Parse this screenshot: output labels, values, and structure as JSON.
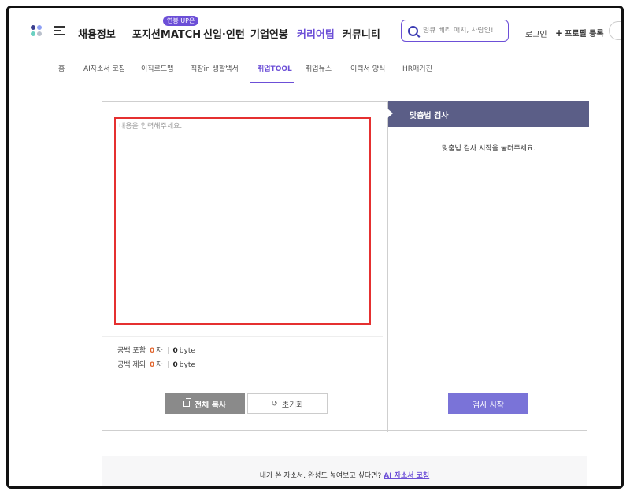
{
  "nav": {
    "items": [
      {
        "label": "채용정보"
      },
      {
        "label": "포지션MATCH"
      },
      {
        "label": "신입·인턴"
      },
      {
        "label": "기업연봉"
      },
      {
        "label": "커리어팁"
      },
      {
        "label": "커뮤니티"
      }
    ],
    "badge": "연봉 UP은",
    "search_placeholder": "멍큐 베리 매치, 사람인!",
    "login": "로그인",
    "profile_plus": "+",
    "profile": "프로필 등록"
  },
  "subnav": {
    "items": [
      {
        "label": "홈"
      },
      {
        "label": "AI자소서 코칭"
      },
      {
        "label": "이직로드맵"
      },
      {
        "label": "직장in 생활백서"
      },
      {
        "label": "취업TOOL"
      },
      {
        "label": "취업뉴스"
      },
      {
        "label": "이력서 양식"
      },
      {
        "label": "HR매거진"
      }
    ]
  },
  "editor": {
    "placeholder": "내용을 입력해주세요."
  },
  "counts": {
    "with_space_label": "공백 포함",
    "without_space_label": "공백 제외",
    "chars_with_space": "0",
    "chars_without_space": "0",
    "char_unit": "자",
    "bytes_with_space": "0",
    "bytes_without_space": "0",
    "byte_unit": "byte"
  },
  "buttons": {
    "copy_all": "전체 복사",
    "reset": "초기화",
    "check_start": "검사 시작"
  },
  "spellcheck": {
    "title": "맞춤법 검사",
    "message": "맞춤법 검사 시작을 눌러주세요."
  },
  "promo": {
    "text": "내가 쓴 자소서, 완성도 높여보고 싶다면?",
    "link": "AI 자소서 코칭"
  },
  "colors": {
    "accent": "#6c4fd7",
    "header_bg": "#5b5e87",
    "highlight": "#e53030",
    "count_number": "#e0622a"
  }
}
